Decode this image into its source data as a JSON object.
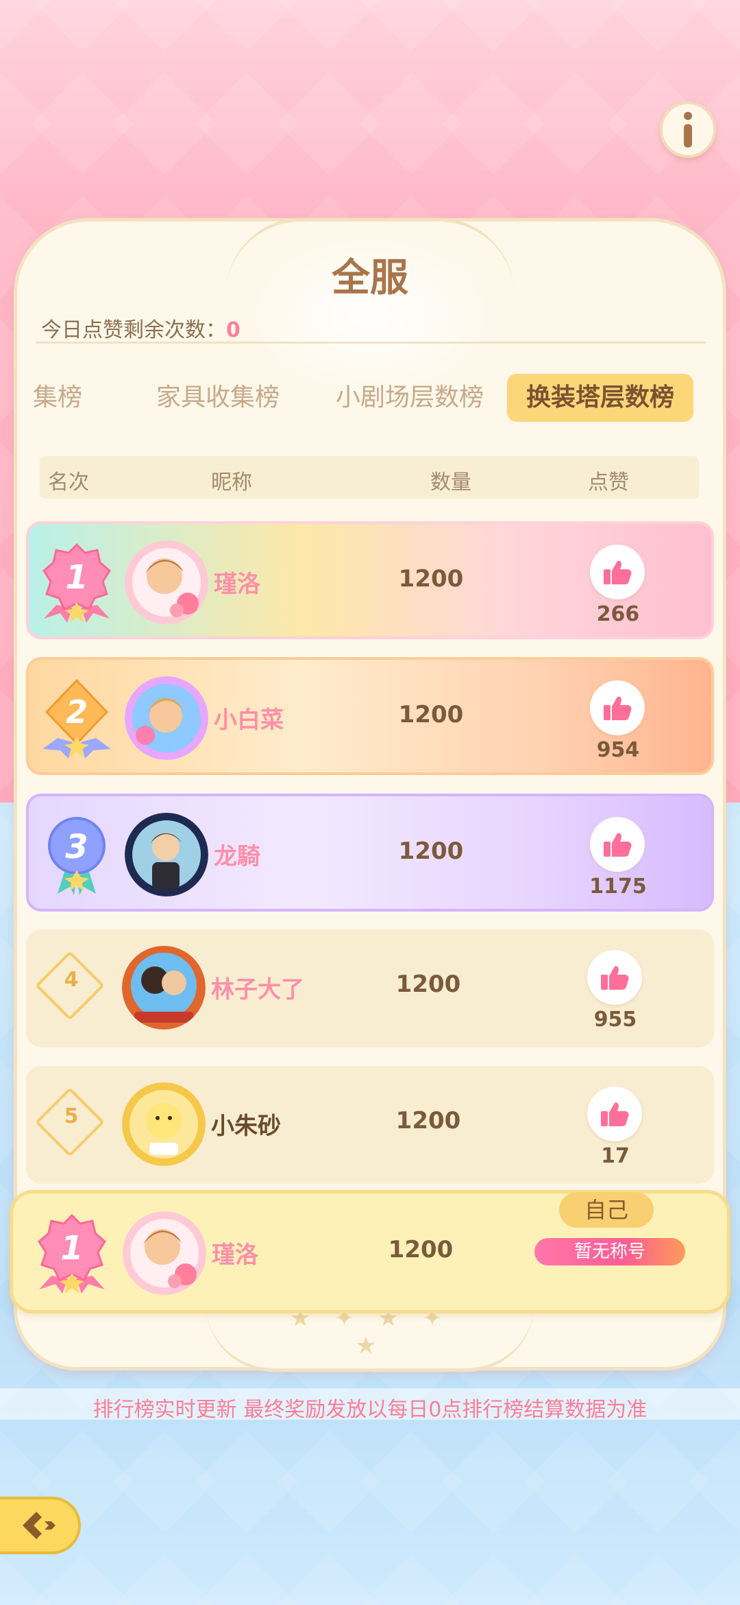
{
  "panel": {
    "title": "全服",
    "likes_remaining_label": "今日点赞剩余次数：",
    "likes_remaining_value": "0"
  },
  "tabs": [
    {
      "label": "集榜",
      "active": false
    },
    {
      "label": "家具收集榜",
      "active": false
    },
    {
      "label": "小剧场层数榜",
      "active": false
    },
    {
      "label": "换装塔层数榜",
      "active": true
    }
  ],
  "table_headers": {
    "rank": "名次",
    "nickname": "昵称",
    "count": "数量",
    "likes": "点赞"
  },
  "rows": [
    {
      "rank": "1",
      "name": "瑾洛",
      "count": "1200",
      "likes": "266",
      "name_color": "#ff8fa9"
    },
    {
      "rank": "2",
      "name": "小白菜",
      "count": "1200",
      "likes": "954",
      "name_color": "#ff8fa9"
    },
    {
      "rank": "3",
      "name": "龙騎",
      "count": "1200",
      "likes": "1175",
      "name_color": "#ff8fa9"
    },
    {
      "rank": "4",
      "name": "林子大了",
      "count": "1200",
      "likes": "955",
      "name_color": "#ff8fa9"
    },
    {
      "rank": "5",
      "name": "小朱砂",
      "count": "1200",
      "likes": "17",
      "name_color": "#6b4a2d"
    }
  ],
  "self": {
    "tag": "自己",
    "rank": "1",
    "name": "瑾洛",
    "count": "1200",
    "title_badge": "暂无称号"
  },
  "footer": {
    "notice": "排行榜实时更新 最终奖励发放以每日0点排行榜结算数据为准"
  },
  "icons": {
    "info": "info-icon",
    "like": "thumbs-up-icon",
    "back": "back-arrow-icon"
  },
  "colors": {
    "accent_pink": "#ff7f9a",
    "gold": "#fcd77a",
    "brown_text": "#7b5a3c"
  }
}
